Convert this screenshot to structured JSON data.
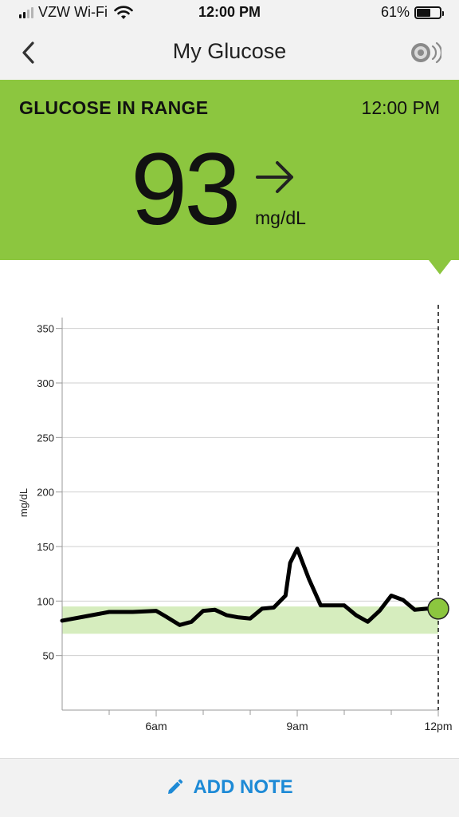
{
  "status_bar": {
    "carrier": "VZW Wi-Fi",
    "time": "12:00 PM",
    "battery_percent": "61%",
    "battery_level": 0.61,
    "signal_bars_active": 2,
    "signal_bars_total": 4
  },
  "nav": {
    "title": "My Glucose",
    "back_icon": "chevron-left-icon",
    "sensor_icon": "sensor-scan-icon"
  },
  "reading": {
    "status": "GLUCOSE IN RANGE",
    "time": "12:00 PM",
    "value": "93",
    "unit": "mg/dL",
    "trend_icon": "arrow-right-icon"
  },
  "footer": {
    "add_note_label": "ADD NOTE",
    "add_note_icon": "pencil-icon"
  },
  "colors": {
    "in_range_green": "#8cc63f",
    "target_band": "#d6edbe",
    "link_blue": "#1d8ad6"
  },
  "chart_data": {
    "type": "line",
    "ylabel": "mg/dL",
    "xlabel": "",
    "ylim": [
      0,
      360
    ],
    "yticks": [
      50,
      100,
      150,
      200,
      250,
      300,
      350
    ],
    "xlim": [
      4,
      12
    ],
    "xticks": [
      {
        "x": 6,
        "label": "6am"
      },
      {
        "x": 9,
        "label": "9am"
      },
      {
        "x": 12,
        "label": "12pm"
      }
    ],
    "minor_xticks": [
      5,
      7,
      8,
      10,
      11
    ],
    "grid": true,
    "target_range": [
      70,
      95
    ],
    "now_x": 12,
    "current_point": {
      "x": 12,
      "y": 93
    },
    "series": [
      {
        "x": [
          4.0,
          4.5,
          5.0,
          5.5,
          6.0,
          6.2,
          6.5,
          6.75,
          7.0,
          7.25,
          7.5,
          7.75,
          8.0,
          8.25,
          8.5,
          8.75,
          8.85,
          9.0,
          9.25,
          9.5,
          9.75,
          10.0,
          10.25,
          10.5,
          10.75,
          11.0,
          11.25,
          11.5,
          11.75,
          12.0
        ],
        "y": [
          82,
          86,
          90,
          90,
          91,
          86,
          78,
          81,
          91,
          92,
          87,
          85,
          84,
          93,
          94,
          105,
          135,
          148,
          120,
          96,
          96,
          96,
          87,
          81,
          91,
          105,
          101,
          92,
          93,
          93
        ]
      }
    ]
  }
}
